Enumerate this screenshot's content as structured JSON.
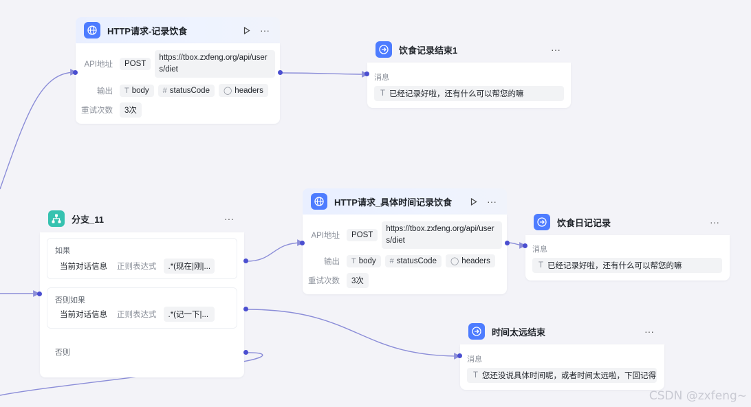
{
  "nodes": {
    "http1": {
      "title": "HTTP请求-记录饮食",
      "api_label": "API地址",
      "method": "POST",
      "url": "https://tbox.zxfeng.org/api/users/diet",
      "output_label": "输出",
      "outputs": [
        "body",
        "statusCode",
        "headers"
      ],
      "retry_label": "重试次数",
      "retry_value": "3次"
    },
    "end1": {
      "title": "饮食记录结束1",
      "msg_label": "消息",
      "message": "已经记录好啦，还有什么可以帮您的嘛"
    },
    "branch": {
      "title": "分支_11",
      "branches": [
        {
          "label": "如果",
          "left": "当前对话信息",
          "op": "正则表达式",
          "right": ".*(现在|刚|..."
        },
        {
          "label": "否则如果",
          "left": "当前对话信息",
          "op": "正则表达式",
          "right": ".*(记一下|..."
        },
        {
          "label": "否则"
        }
      ]
    },
    "http2": {
      "title": "HTTP请求_具体时间记录饮食",
      "api_label": "API地址",
      "method": "POST",
      "url": "https://tbox.zxfeng.org/api/users/diet",
      "output_label": "输出",
      "outputs": [
        "body",
        "statusCode",
        "headers"
      ],
      "retry_label": "重试次数",
      "retry_value": "3次"
    },
    "end2": {
      "title": "饮食日记记录",
      "msg_label": "消息",
      "message": "已经记录好啦，还有什么可以帮您的嘛"
    },
    "end3": {
      "title": "时间太远结束",
      "msg_label": "消息",
      "message": "您还没说具体时间呢，或者时间太远啦，下回记得..."
    }
  },
  "icons": {
    "http": "globe-icon",
    "end": "arrow-right-circle-icon",
    "branch": "branch-icon",
    "run": "play-icon",
    "more": "more-icon",
    "text_type": "text-type-icon",
    "number_type": "hash-icon",
    "object_type": "person-icon"
  },
  "colors": {
    "edge": "#8b8dd8",
    "port": "#4a4ed0",
    "icon_blue": "#4d7cff",
    "icon_teal": "#36c2b0"
  },
  "watermark": "CSDN @zxfeng~"
}
